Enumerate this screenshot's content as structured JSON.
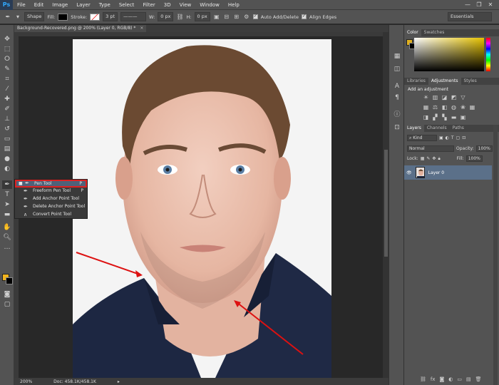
{
  "menubar": {
    "logo": "Ps",
    "items": [
      "File",
      "Edit",
      "Image",
      "Layer",
      "Type",
      "Select",
      "Filter",
      "3D",
      "View",
      "Window",
      "Help"
    ],
    "window_controls": [
      "—",
      "❐",
      "✕"
    ]
  },
  "options": {
    "mode": "Shape",
    "fill_label": "Fill:",
    "stroke_label": "Stroke:",
    "stroke_width": "3 pt",
    "w_label": "W:",
    "w_value": "0 px",
    "h_label": "H:",
    "h_value": "0 px",
    "auto_add_delete": "Auto Add/Delete",
    "align_edges": "Align Edges",
    "workspace": "Essentials"
  },
  "document": {
    "tab_title": "Background-Recovered.png @ 200% (Layer 0, RGB/8) *",
    "close": "×"
  },
  "status": {
    "zoom": "200%",
    "doc": "Doc: 458.1K/458.1K"
  },
  "flyout": {
    "items": [
      {
        "label": "Pen Tool",
        "key": "P",
        "icon": "pen-icon"
      },
      {
        "label": "Freeform Pen Tool",
        "key": "P",
        "icon": "freeform-pen-icon"
      },
      {
        "label": "Add Anchor Point Tool",
        "key": "",
        "icon": "add-anchor-icon"
      },
      {
        "label": "Delete Anchor Point Tool",
        "key": "",
        "icon": "delete-anchor-icon"
      },
      {
        "label": "Convert Point Tool",
        "key": "",
        "icon": "convert-point-icon"
      }
    ]
  },
  "panels": {
    "color_tabs": [
      "Color",
      "Swatches"
    ],
    "adjust_tabs": [
      "Libraries",
      "Adjustments",
      "Styles"
    ],
    "adjust_title": "Add an adjustment",
    "layers_tabs": [
      "Layers",
      "Channels",
      "Paths"
    ],
    "kind": "Kind",
    "blend_mode": "Normal",
    "opacity_label": "Opacity:",
    "opacity_value": "100%",
    "lock_label": "Lock:",
    "fill_label": "Fill:",
    "fill_value": "100%",
    "layer_name": "Layer 0"
  },
  "colors": {
    "foreground": "#f0b31d",
    "background": "#000000",
    "selection_highlight": "#d22222",
    "annotation_arrows": "#dd1111"
  }
}
